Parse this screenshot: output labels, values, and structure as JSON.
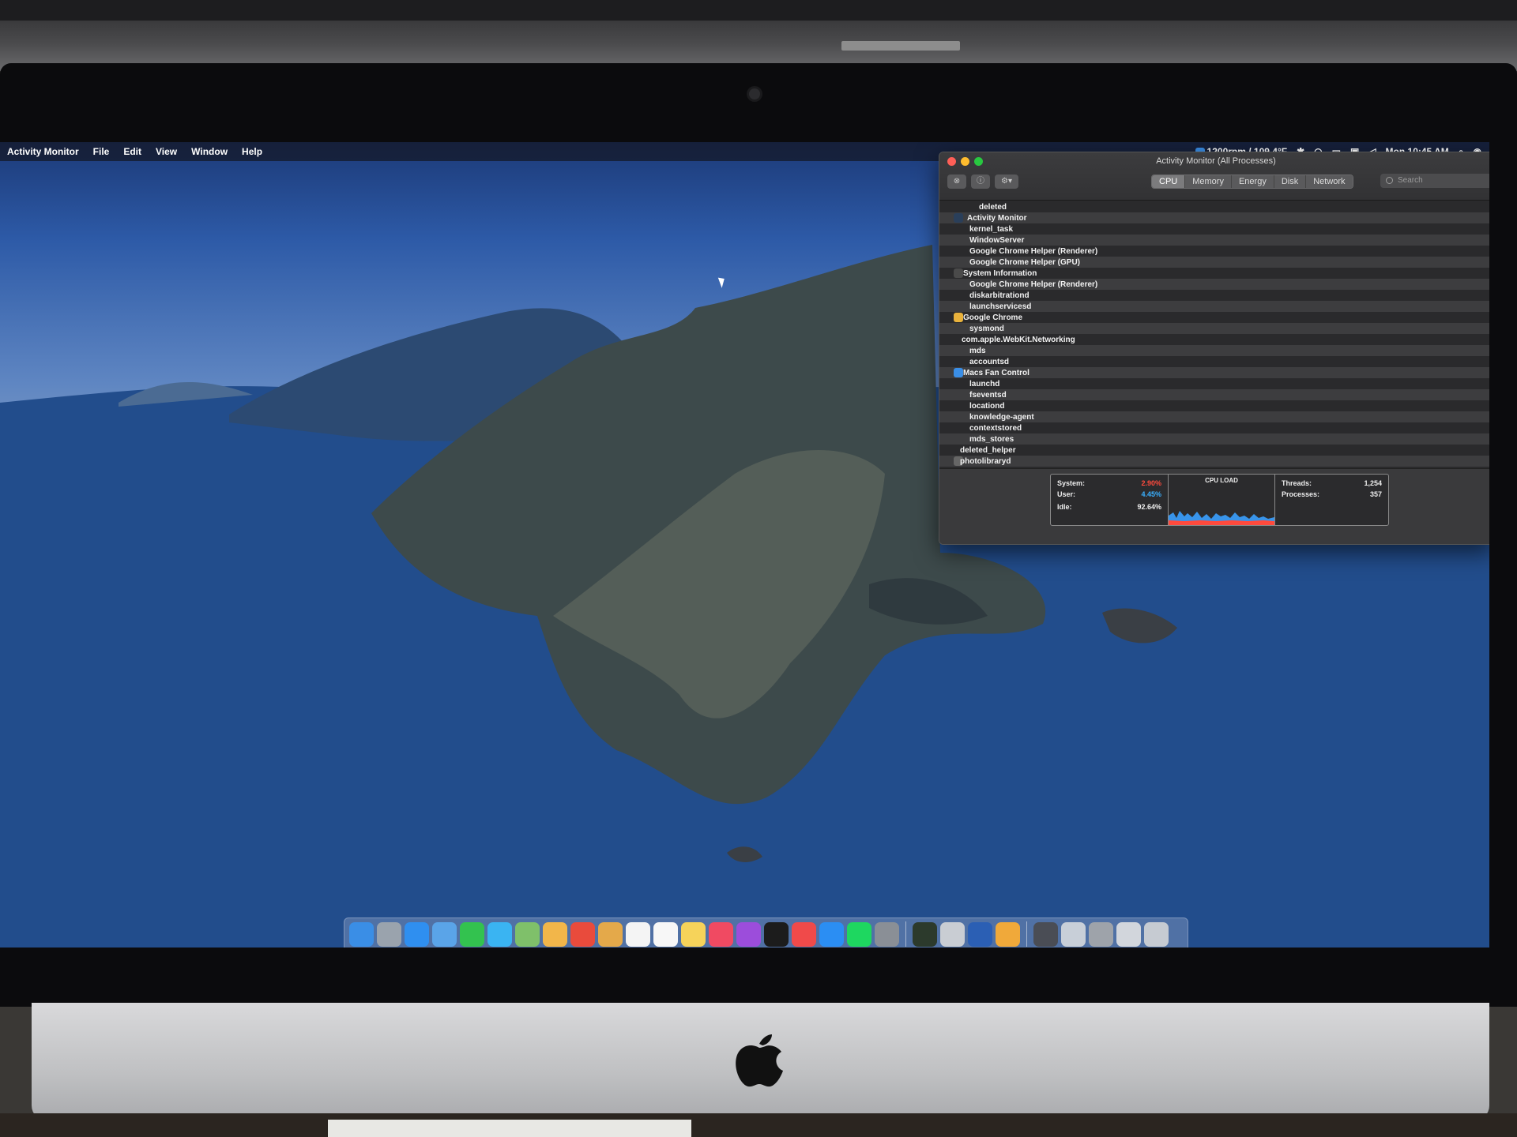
{
  "menubar": {
    "app_name": "Activity Monitor",
    "items": [
      "File",
      "Edit",
      "View",
      "Window",
      "Help"
    ],
    "status_fan": "1200rpm / 109.4°F",
    "clock": "Mon 10:45 AM"
  },
  "window": {
    "title": "Activity Monitor (All Processes)",
    "tabs": [
      "CPU",
      "Memory",
      "Energy",
      "Disk",
      "Network"
    ],
    "active_tab": "CPU",
    "search_placeholder": "Search",
    "processes": [
      {
        "name": "deleted",
        "icon": ""
      },
      {
        "name": "Activity Monitor",
        "icon": "activity-monitor-icon"
      },
      {
        "name": "kernel_task",
        "icon": ""
      },
      {
        "name": "WindowServer",
        "icon": ""
      },
      {
        "name": "Google Chrome Helper (Renderer)",
        "icon": ""
      },
      {
        "name": "Google Chrome Helper (GPU)",
        "icon": ""
      },
      {
        "name": "System Information",
        "icon": "system-information-icon"
      },
      {
        "name": "Google Chrome Helper (Renderer)",
        "icon": ""
      },
      {
        "name": "diskarbitrationd",
        "icon": ""
      },
      {
        "name": "launchservicesd",
        "icon": ""
      },
      {
        "name": "Google Chrome",
        "icon": "chrome-icon"
      },
      {
        "name": "sysmond",
        "icon": ""
      },
      {
        "name": "com.apple.WebKit.Networking",
        "icon": ""
      },
      {
        "name": "mds",
        "icon": ""
      },
      {
        "name": "accountsd",
        "icon": ""
      },
      {
        "name": "Macs Fan Control",
        "icon": "fan-control-icon"
      },
      {
        "name": "launchd",
        "icon": ""
      },
      {
        "name": "fseventsd",
        "icon": ""
      },
      {
        "name": "locationd",
        "icon": ""
      },
      {
        "name": "knowledge-agent",
        "icon": ""
      },
      {
        "name": "contextstored",
        "icon": ""
      },
      {
        "name": "mds_stores",
        "icon": ""
      },
      {
        "name": "deleted_helper",
        "icon": ""
      },
      {
        "name": "photolibraryd",
        "icon": "photos-doc-icon"
      }
    ],
    "stats": {
      "system_label": "System:",
      "system_value": "2.90%",
      "user_label": "User:",
      "user_value": "4.45%",
      "idle_label": "Idle:",
      "idle_value": "92.64%",
      "cpu_load_label": "CPU LOAD",
      "threads_label": "Threads:",
      "threads_value": "1,254",
      "processes_label": "Processes:",
      "processes_value": "357"
    }
  },
  "dock": {
    "apps": [
      {
        "name": "finder-icon",
        "color": "#3a8ee6"
      },
      {
        "name": "launchpad-icon",
        "color": "#9aa3ad"
      },
      {
        "name": "safari-icon",
        "color": "#2f8ff0"
      },
      {
        "name": "mail-icon",
        "color": "#5aa4e8"
      },
      {
        "name": "facetime-icon",
        "color": "#33c24f"
      },
      {
        "name": "messages-icon",
        "color": "#3ab4f2"
      },
      {
        "name": "maps-icon",
        "color": "#7fc06a"
      },
      {
        "name": "photos-icon",
        "color": "#f2b64a"
      },
      {
        "name": "chrome-icon",
        "color": "#e94b3c"
      },
      {
        "name": "contacts-icon",
        "color": "#e4a94a"
      },
      {
        "name": "calendar-icon",
        "color": "#f4f4f4"
      },
      {
        "name": "reminders-icon",
        "color": "#f7f7f7"
      },
      {
        "name": "notes-icon",
        "color": "#f6d35a"
      },
      {
        "name": "music-icon",
        "color": "#f04a62"
      },
      {
        "name": "podcasts-icon",
        "color": "#9c4ddb"
      },
      {
        "name": "tv-icon",
        "color": "#1c1c1c"
      },
      {
        "name": "news-icon",
        "color": "#f04a4a"
      },
      {
        "name": "app-store-icon",
        "color": "#2b8ef3"
      },
      {
        "name": "spotify-icon",
        "color": "#1ed760"
      },
      {
        "name": "system-preferences-icon",
        "color": "#8a8f96"
      }
    ],
    "apps2": [
      {
        "name": "activity-monitor-icon",
        "color": "#2c3a2c"
      },
      {
        "name": "disk-utility-icon",
        "color": "#c9cdd3"
      },
      {
        "name": "word-icon",
        "color": "#2b5fb4"
      },
      {
        "name": "app-icon",
        "color": "#f0a93a"
      }
    ],
    "stack": [
      {
        "name": "downloads-stack-icon",
        "color": "#4a4d55"
      },
      {
        "name": "document-stack-icon",
        "color": "#c8cfd8"
      },
      {
        "name": "document-stack-icon-2",
        "color": "#9ea3aa"
      },
      {
        "name": "document-stack-icon-3",
        "color": "#d2d6dc"
      },
      {
        "name": "trash-icon",
        "color": "#c6cbd2"
      }
    ]
  }
}
